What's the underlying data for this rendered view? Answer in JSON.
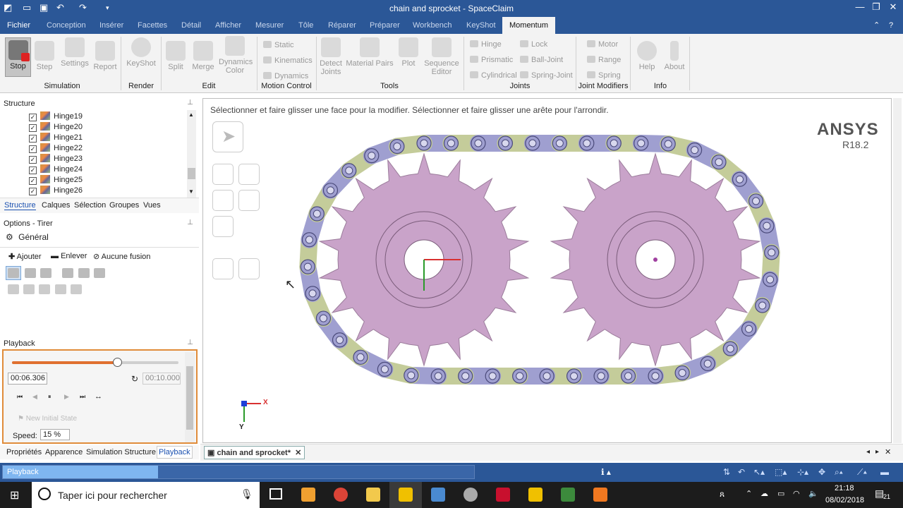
{
  "window": {
    "title": "chain and sprocket - SpaceClaim"
  },
  "menu": {
    "tabs": [
      "Fichier",
      "Conception",
      "Insérer",
      "Facettes",
      "Détail",
      "Afficher",
      "Mesurer",
      "Tôle",
      "Réparer",
      "Préparer",
      "Workbench",
      "KeyShot",
      "Momentum"
    ],
    "active": "Momentum"
  },
  "ribbon": {
    "simulation": {
      "stop": "Stop",
      "step": "Step",
      "settings": "Settings",
      "report": "Report",
      "group": "Simulation"
    },
    "render": {
      "keyshot": "KeyShot",
      "group": "Render"
    },
    "edit": {
      "split": "Split",
      "merge": "Merge",
      "dynamics_color": "Dynamics Color",
      "group": "Edit"
    },
    "motion_control": {
      "static": "Static",
      "kinematics": "Kinematics",
      "dynamics": "Dynamics",
      "group": "Motion Control"
    },
    "tools": {
      "detect_joints": "Detect Joints",
      "material_pairs": "Material Pairs",
      "plot": "Plot",
      "sequence_editor": "Sequence Editor",
      "group": "Tools"
    },
    "joints": {
      "hinge": "Hinge",
      "prismatic": "Prismatic",
      "cylindrical": "Cylindrical",
      "lock": "Lock",
      "ball_joint": "Ball-Joint",
      "spring_joint": "Spring-Joint",
      "group": "Joints"
    },
    "joint_modifiers": {
      "motor": "Motor",
      "range": "Range",
      "spring": "Spring",
      "group": "Joint Modifiers"
    },
    "info": {
      "help": "Help",
      "about": "About",
      "group": "Info"
    }
  },
  "structure": {
    "title": "Structure",
    "items": [
      "Hinge19",
      "Hinge20",
      "Hinge21",
      "Hinge22",
      "Hinge23",
      "Hinge24",
      "Hinge25",
      "Hinge26"
    ],
    "tabs": [
      "Structure",
      "Calques",
      "Sélection",
      "Groupes",
      "Vues"
    ]
  },
  "options": {
    "title": "Options - Tirer",
    "general": "Général",
    "add": "Ajouter",
    "remove": "Enlever",
    "no_merge": "Aucune fusion"
  },
  "playback": {
    "title": "Playback",
    "current_time": "00:06.306",
    "end_time": "00:10.000",
    "progress": 0.63,
    "new_initial_state": "New Initial State",
    "speed_label": "Speed:",
    "speed_value": "15 %",
    "tabs": [
      "Propriétés",
      "Apparence",
      "Simulation Structure",
      "Playback"
    ]
  },
  "viewport": {
    "hint": "Sélectionner et faire glisser une face pour la modifier. Sélectionner et faire glisser une arête pour l'arrondir.",
    "brand": "ANSYS",
    "version": "R18.2",
    "axis_x": "X",
    "axis_y": "Y",
    "doc_tab": "chain and sprocket*"
  },
  "statusbar": {
    "label": "Playback",
    "progress": 0.33
  },
  "taskbar": {
    "search_placeholder": "Taper ici pour rechercher",
    "time": "21:18",
    "date": "08/02/2018",
    "notif": "21"
  },
  "colors": {
    "accent": "#2b5797",
    "sprocket": "#c9a3c9",
    "link": "#9f9fd0",
    "link_plate": "#c4cc9a"
  }
}
